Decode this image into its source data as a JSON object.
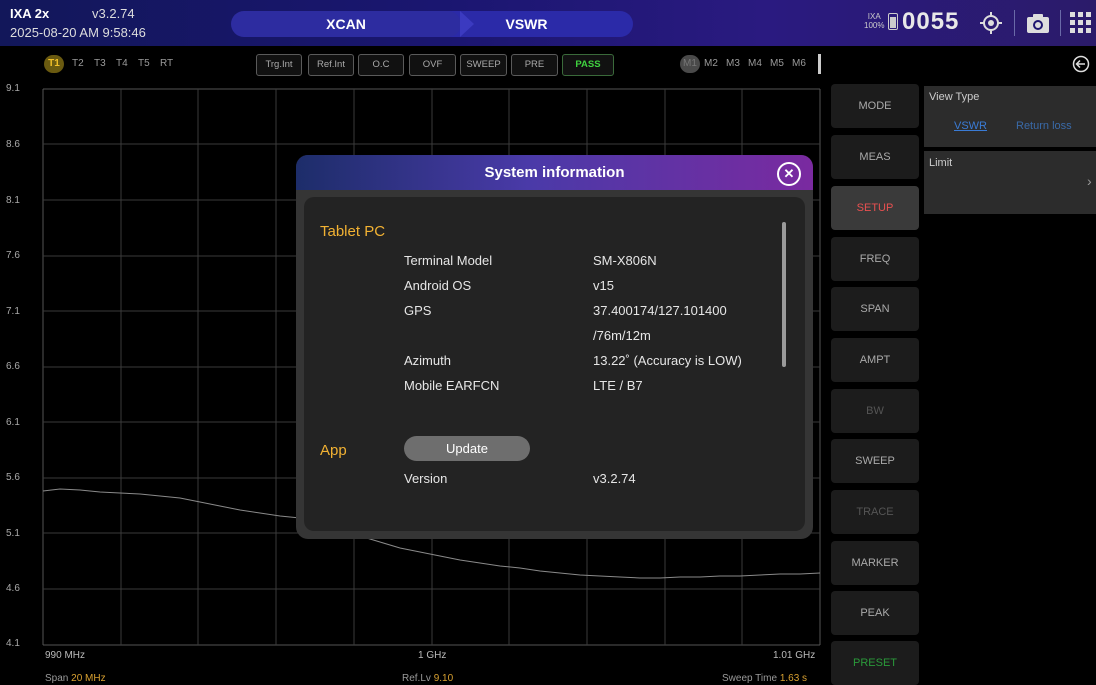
{
  "topbar": {
    "app_name": "IXA 2x",
    "version": "v3.2.74",
    "datetime": "2025-08-20 AM 9:58:46",
    "tabs": [
      "XCAN",
      "VSWR"
    ],
    "device_label": "IXA",
    "battery": "100%",
    "counter": "0055"
  },
  "traces": [
    "T1",
    "T2",
    "T3",
    "T4",
    "T5",
    "RT"
  ],
  "indicators": [
    "Trg.Int",
    "Ref.Int",
    "O.C",
    "OVF",
    "SWEEP",
    "PRE",
    "PASS"
  ],
  "markers": [
    "M1",
    "M2",
    "M3",
    "M4",
    "M5",
    "M6"
  ],
  "graph": {
    "y_ticks": [
      "9.1",
      "8.6",
      "8.1",
      "7.6",
      "7.1",
      "6.6",
      "6.1",
      "5.6",
      "5.1",
      "4.6",
      "4.1"
    ],
    "x_start": "990 MHz",
    "x_center": "1 GHz",
    "x_end": "1.01 GHz",
    "span_label": "Span",
    "span_value": "20 MHz",
    "reflv_label": "Ref.Lv",
    "reflv_value": "9.10",
    "sweep_label": "Sweep Time",
    "sweep_value": "1.63 s"
  },
  "menu": [
    "MODE",
    "MEAS",
    "SETUP",
    "FREQ",
    "SPAN",
    "AMPT",
    "BW",
    "SWEEP",
    "TRACE",
    "MARKER",
    "PEAK",
    "PRESET"
  ],
  "right_panel": {
    "view_type_label": "View Type",
    "view_options": [
      "VSWR",
      "Return loss"
    ],
    "limit_label": "Limit",
    "chevron": "›"
  },
  "dialog": {
    "title": "System information",
    "tablet_section": "Tablet PC",
    "rows": [
      {
        "label": "Terminal Model",
        "value": "SM-X806N"
      },
      {
        "label": "Android OS",
        "value": "v15"
      },
      {
        "label": "GPS",
        "value": "37.400174/127.101400"
      },
      {
        "label": "",
        "value": "/76m/12m"
      },
      {
        "label": "Azimuth",
        "value": "13.22˚ (Accuracy is LOW)"
      },
      {
        "label": "Mobile EARFCN",
        "value": "LTE / B7"
      }
    ],
    "app_section": "App",
    "update_button": "Update",
    "version_label": "Version",
    "version_value": "v3.2.74"
  },
  "colors": {
    "accent": "#f2b233",
    "pass_green": "#3fd13f",
    "link_blue": "#3a7bd5",
    "preset_green": "#2a9a3a"
  }
}
